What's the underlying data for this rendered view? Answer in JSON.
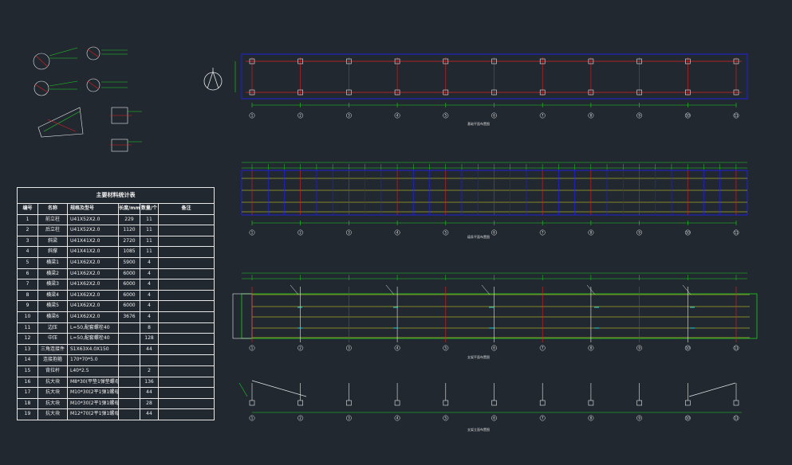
{
  "table": {
    "title": "主要材料统计表",
    "headers": [
      "编号",
      "名称",
      "规格及型号",
      "长度/mm",
      "数量/个",
      "备注"
    ],
    "rows": [
      [
        "1",
        "前立柱",
        "U41X52X2.0",
        "229",
        "11",
        ""
      ],
      [
        "2",
        "后立柱",
        "U41X52X2.0",
        "1120",
        "11",
        ""
      ],
      [
        "3",
        "斜梁",
        "U41X41X2.0",
        "2720",
        "11",
        ""
      ],
      [
        "4",
        "斜撑",
        "U41X41X2.0",
        "1085",
        "11",
        ""
      ],
      [
        "5",
        "横梁1",
        "U41X62X2.0",
        "5900",
        "4",
        ""
      ],
      [
        "6",
        "横梁2",
        "U41X62X2.0",
        "6000",
        "4",
        ""
      ],
      [
        "7",
        "横梁3",
        "U41X62X2.0",
        "6000",
        "4",
        ""
      ],
      [
        "8",
        "横梁4",
        "U41X62X2.0",
        "6000",
        "4",
        ""
      ],
      [
        "9",
        "横梁5",
        "U41X62X2.0",
        "6000",
        "4",
        ""
      ],
      [
        "10",
        "横梁6",
        "U41X62X2.0",
        "3676",
        "4",
        ""
      ],
      [
        "11",
        "边压",
        "L=50,配套螺栓40",
        "",
        "8",
        ""
      ],
      [
        "12",
        "中压",
        "L=50,配套螺栓40",
        "",
        "128",
        ""
      ],
      [
        "13",
        "三角连接件",
        "S1X63X4.0X150",
        "",
        "44",
        ""
      ],
      [
        "14",
        "连接抱箍",
        "170*70*5.0",
        "",
        "",
        ""
      ],
      [
        "15",
        "背拉杆",
        "L40*2.5",
        "",
        "2",
        ""
      ],
      [
        "16",
        "抗大块",
        "M8*30(平垫1弹垫螺母)",
        "",
        "136",
        ""
      ],
      [
        "17",
        "抗大块",
        "M10*30(2平1弹1螺母)",
        "",
        "44",
        ""
      ],
      [
        "18",
        "抗大块",
        "M10*30(2平1弹1螺母)",
        "",
        "28",
        ""
      ],
      [
        "19",
        "抗大块",
        "M12*70(2平1弹1螺母)",
        "",
        "44",
        ""
      ]
    ]
  },
  "plans": {
    "grid_labels": [
      "1",
      "2",
      "3",
      "4",
      "5",
      "6",
      "7",
      "8",
      "9",
      "10",
      "11"
    ],
    "captions": [
      "基础平面布置图",
      "檩条平面布置图",
      "支架平面布置图",
      "支架立面布置图"
    ]
  },
  "colors": {
    "background": "#212830",
    "grid_blue": "#2020ff",
    "grid_red": "#e02020",
    "dim_green": "#20d020",
    "purlin_yellow": "#e8e820",
    "line_white": "#e8e8e8",
    "accent_cyan": "#20d0e0"
  }
}
